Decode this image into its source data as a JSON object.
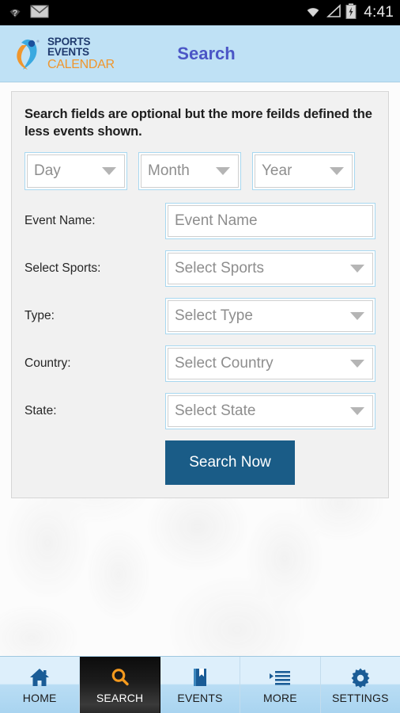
{
  "statusbar": {
    "time": "4:41",
    "left_icons": [
      "wifi-question-icon",
      "envelope-icon"
    ],
    "right_icons": [
      "wifi-icon",
      "signal-triangle-icon",
      "battery-charging-icon"
    ]
  },
  "header": {
    "logo_line1": "SPORTS EVENTS",
    "logo_line2": "CALENDAR",
    "title": "Search",
    "bg_color": "#bfe1f5",
    "title_color": "#4b56c6"
  },
  "form": {
    "heading": "Search fields are optional but the more feilds defined the less events shown.",
    "date_fields": [
      {
        "name": "day",
        "value": "Day"
      },
      {
        "name": "month",
        "value": "Month"
      },
      {
        "name": "year",
        "value": "Year"
      }
    ],
    "rows": [
      {
        "label": "Event Name:",
        "value": "Event Name",
        "type": "text"
      },
      {
        "label": "Select Sports:",
        "value": "Select Sports",
        "type": "select"
      },
      {
        "label": "Type:",
        "value": "Select Type",
        "type": "select"
      },
      {
        "label": "Country:",
        "value": "Select Country",
        "type": "select"
      },
      {
        "label": "State:",
        "value": "Select State",
        "type": "select"
      }
    ],
    "submit_label": "Search Now",
    "submit_color": "#1a5c87"
  },
  "bottomnav": {
    "items": [
      {
        "label": "HOME",
        "icon": "home-icon",
        "active": false
      },
      {
        "label": "SEARCH",
        "icon": "search-icon",
        "active": true
      },
      {
        "label": "EVENTS",
        "icon": "book-icon",
        "active": false
      },
      {
        "label": "MORE",
        "icon": "list-icon",
        "active": false
      },
      {
        "label": "SETTINGS",
        "icon": "gear-icon",
        "active": false
      }
    ],
    "icon_color": "#1a5c96",
    "active_icon_color": "#f59a1e"
  }
}
